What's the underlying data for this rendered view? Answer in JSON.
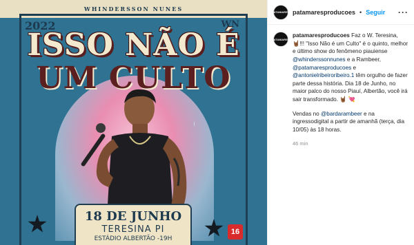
{
  "poster": {
    "brand": "WHINDERSSON NUNES",
    "year": "2022",
    "monogram": "WN",
    "title_line1": "ISSO NÃO É",
    "title_line2": "UM CULTO",
    "date": "18 DE JUNHO",
    "city": "TERESINA PI",
    "venue": "ESTÁDIO ALBERTÃO -19H",
    "rating": "16"
  },
  "post": {
    "avatar_text": "PATAMARES",
    "username": "patamaresproducoes",
    "separator": "•",
    "follow_label": "Seguir",
    "more_label": "···",
    "caption_username": "patamaresproducoes",
    "caption_p1": "Faz o W. Teresina, 🤘🏾!!! \"Isso Não é um Culto\" é o quinto, melhor e último show do fenômeno piauiense",
    "mention_whindersson": "@whinderssonnunes",
    "caption_p1b": "e a Rambeer,",
    "mention_patamares": "@patamaresproducoes",
    "caption_p1c": "e",
    "mention_antonio": "@antonielribeiroribeiro.1",
    "caption_p1d": "têm orgulho de fazer parte dessa história. Dia 18 de Junho, no maior palco do nosso Piauí, Albertão, você irá sair transformado. 🤘🏾 💘",
    "caption_p2a": "Vendas no",
    "mention_bar": "@bardarambeer",
    "caption_p2b": "e na ingressodigital a partir de amanhã (terça, dia 10/05) às 18 horas.",
    "timestamp": "46 min"
  },
  "colors": {
    "poster_blue": "#2f7291",
    "poster_cream": "#efe4c6",
    "poster_navy": "#1d3a4f",
    "title_maroon": "#5b1f1f",
    "follow_blue": "#0095f6",
    "mention_blue": "#00376b",
    "rating_red": "#d92b2b"
  }
}
